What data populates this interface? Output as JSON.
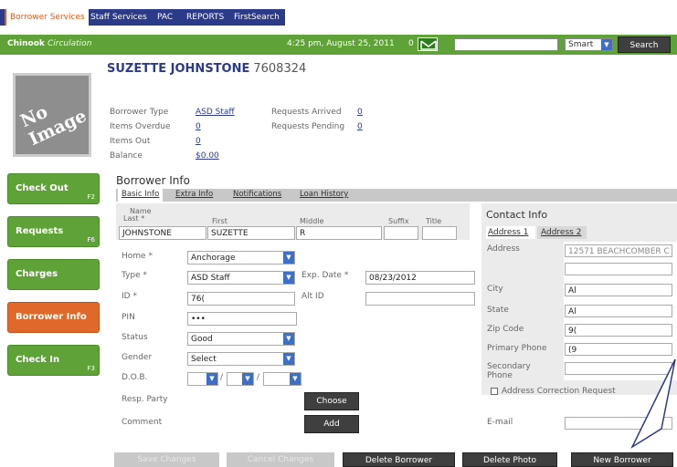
{
  "top_tabs": [
    {
      "label": "Borrower Services"
    },
    {
      "label": "Staff Services"
    },
    {
      "label": "PAC"
    },
    {
      "label": "REPORTS"
    },
    {
      "label": "FirstSearch"
    }
  ],
  "header": {
    "brand": "Chinook",
    "brand_sub": "Circulation",
    "time": "4:25 pm, August 25, 2011",
    "mail_count": "0",
    "search_scope": "Smart",
    "search_button": "Search"
  },
  "no_image_text": "No Image",
  "borrower": {
    "name": "SUZETTE JOHNSTONE",
    "number": "7608324",
    "type_label": "Borrower Type",
    "type_value": "ASD Staff",
    "overdue_label": "Items Overdue",
    "overdue_value": "0",
    "out_label": "Items Out",
    "out_value": "0",
    "balance_label": "Balance",
    "balance_value": "$0.00",
    "arrived_label": "Requests Arrived",
    "arrived_value": "0",
    "pending_label": "Requests Pending",
    "pending_value": "0"
  },
  "nav": [
    {
      "label": "Check Out",
      "key": "F2"
    },
    {
      "label": "Requests",
      "key": "F6"
    },
    {
      "label": "Charges",
      "key": ""
    },
    {
      "label": "Borrower Info",
      "key": ""
    },
    {
      "label": "Check In",
      "key": "F3"
    }
  ],
  "section_title": "Borrower Info",
  "tabs": [
    {
      "label": "Basic Info"
    },
    {
      "label": "Extra Info"
    },
    {
      "label": "Notifications"
    },
    {
      "label": "Loan History"
    }
  ],
  "name_fields": {
    "name_group": "Name",
    "last_label": "Last *",
    "last_value": "JOHNSTONE",
    "first_label": "First",
    "first_value": "SUZETTE",
    "middle_label": "Middle",
    "middle_value": "R",
    "suffix_label": "Suffix",
    "title_label": "Title"
  },
  "form": {
    "home_label": "Home *",
    "home_value": "Anchorage",
    "type_label": "Type *",
    "type_value": "ASD Staff",
    "exp_label": "Exp. Date *",
    "exp_value": "08/23/2012",
    "id_label": "ID *",
    "id_value": "76(",
    "altid_label": "Alt ID",
    "pin_label": "PIN",
    "pin_value": "•••",
    "status_label": "Status",
    "status_value": "Good",
    "gender_label": "Gender",
    "gender_value": "Select",
    "dob_label": "D.O.B.",
    "dob_sep": "/",
    "resp_label": "Resp. Party",
    "choose_button": "Choose",
    "comment_label": "Comment",
    "add_button": "Add"
  },
  "contact": {
    "title": "Contact Info",
    "tab1": "Address 1",
    "tab2": "Address 2",
    "address_label": "Address",
    "address_value": "12571 BEACHCOMBER C",
    "city_label": "City",
    "city_value": "Al",
    "state_label": "State",
    "state_value": "Al",
    "zip_label": "Zip Code",
    "zip_value": "9(",
    "primary_label": "Primary Phone",
    "primary_value": "(9",
    "secondary_label": "Secondary Phone",
    "correction_label": "Address Correction Request",
    "email_label": "E-mail"
  },
  "bottom_buttons": [
    {
      "label": "Save Changes"
    },
    {
      "label": "Cancel Changes"
    },
    {
      "label": "Delete Borrower"
    },
    {
      "label": "Delete Photo"
    },
    {
      "label": "New Borrower"
    }
  ]
}
